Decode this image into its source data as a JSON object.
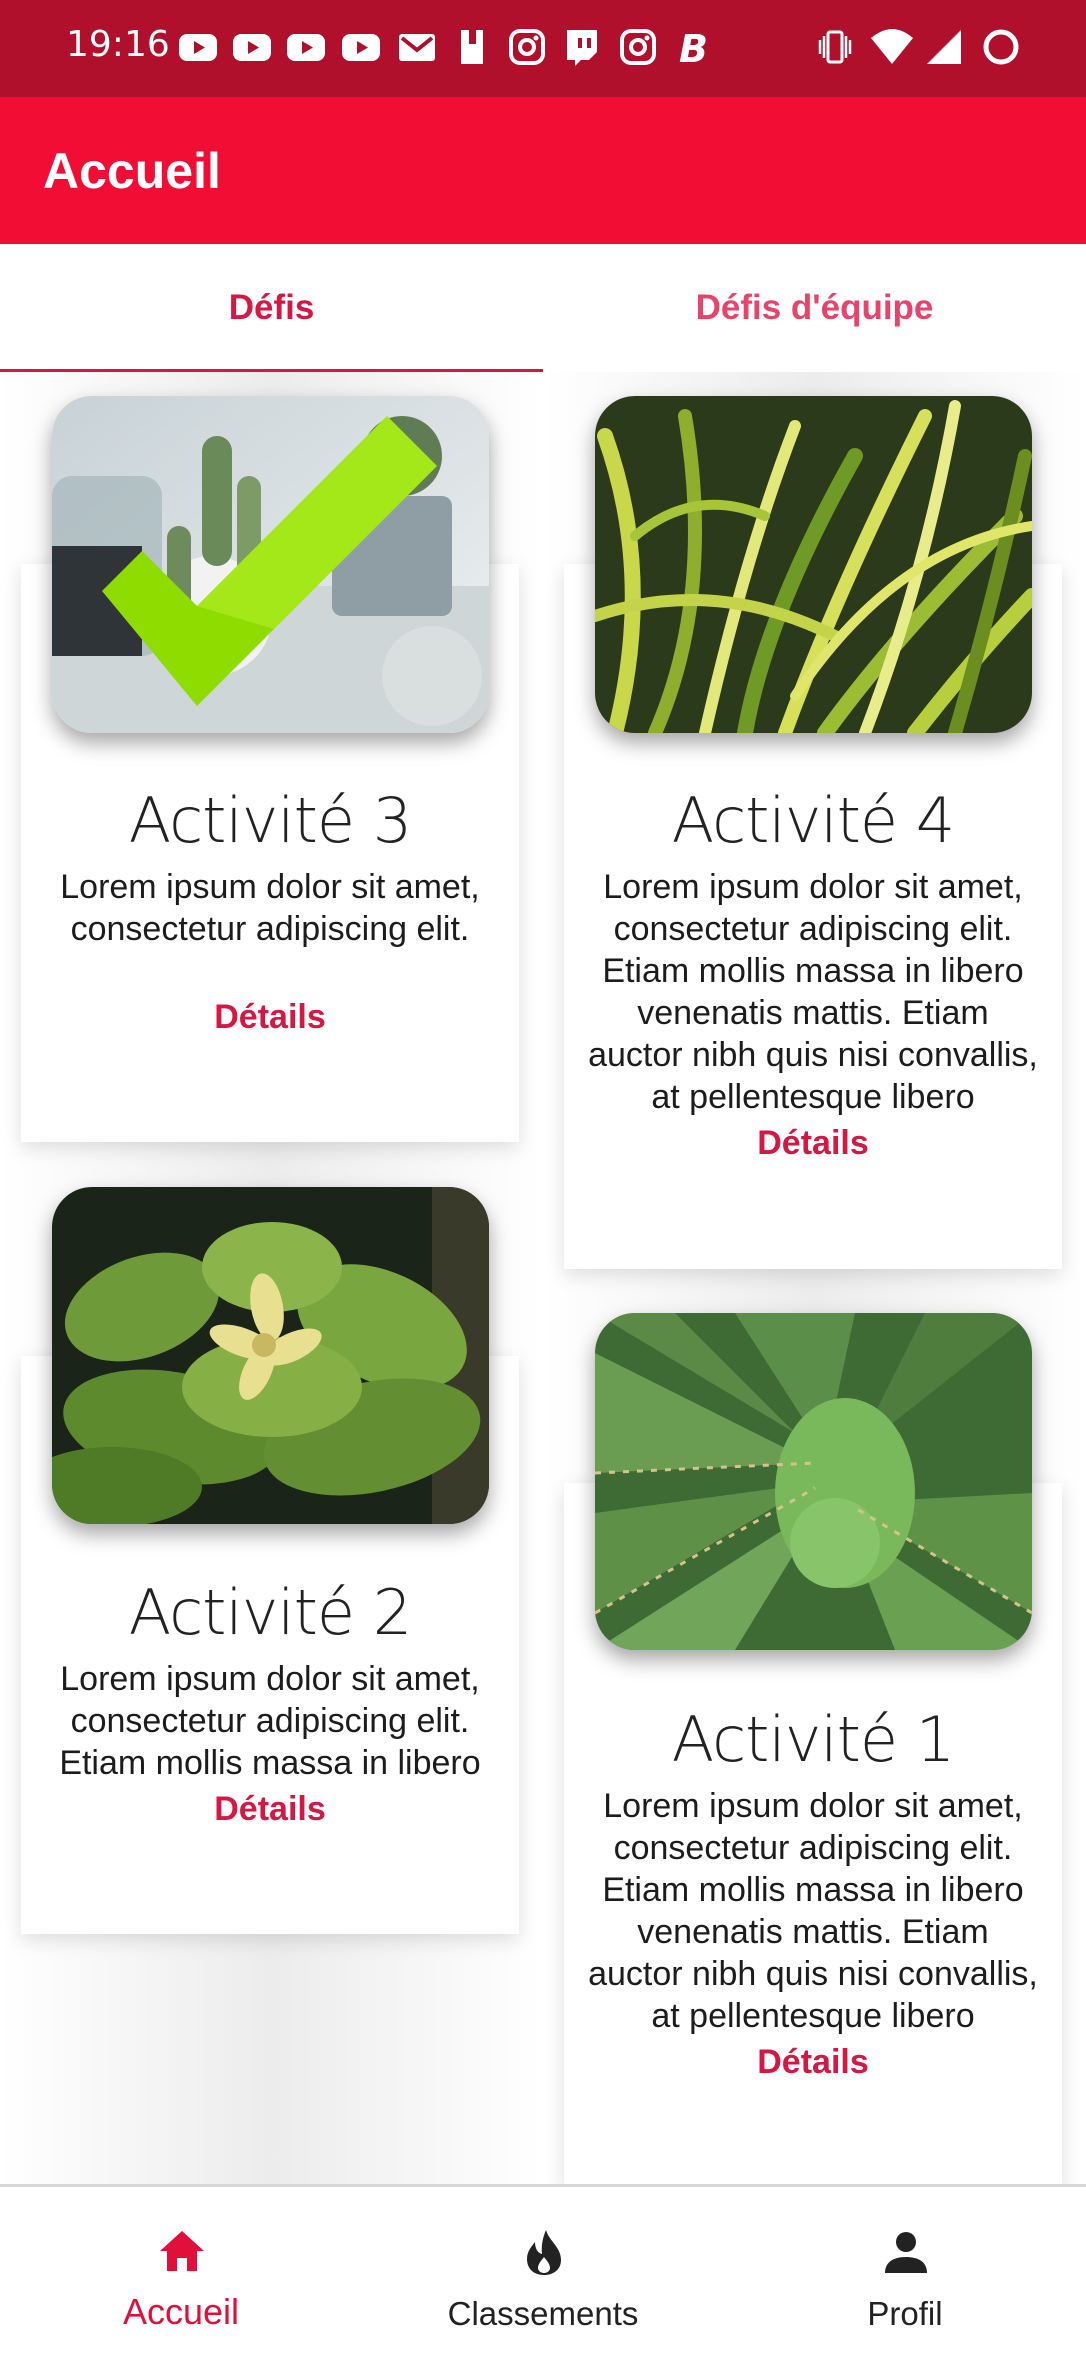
{
  "status_bar": {
    "time": "19:16",
    "left_icons": [
      "youtube-icon",
      "youtube-icon",
      "youtube-icon",
      "youtube-icon",
      "gmail-icon",
      "bookmark-icon",
      "instagram-icon",
      "twitch-icon",
      "instagram-icon",
      "bold-b-icon"
    ],
    "right_icons": [
      "vibrate-icon",
      "wifi-icon",
      "signal-icon",
      "battery-ring-icon"
    ]
  },
  "app_bar": {
    "title": "Accueil"
  },
  "tabs": [
    {
      "label": "Défis",
      "active": true
    },
    {
      "label": "Défis d'équipe",
      "active": false
    }
  ],
  "cards": [
    {
      "title": "Activité 3",
      "description": "Lorem ipsum dolor sit amet, consectetur adipiscing elit.",
      "button": "Détails",
      "image": "cactus-pots-photo",
      "completed": true
    },
    {
      "title": "Activité 4",
      "description": "Lorem ipsum dolor sit amet, consectetur adipiscing elit. Etiam mollis massa in libero venenatis mattis. Etiam auctor nibh quis nisi convallis, at pellentesque libero",
      "button": "Détails",
      "image": "striped-grass-photo",
      "completed": false
    },
    {
      "title": "Activité 2",
      "description": "Lorem ipsum dolor sit amet, consectetur adipiscing elit. Etiam mollis massa in libero venenatis",
      "button": "Détails",
      "image": "leafy-plant-flower-photo",
      "completed": false
    },
    {
      "title": "Activité 1",
      "description": "Lorem ipsum dolor sit amet, consectetur adipiscing elit. Etiam mollis massa in libero venenatis mattis. Etiam auctor nibh quis nisi convallis, at pellentesque libero",
      "button": "Détails",
      "image": "agave-photo",
      "completed": false
    }
  ],
  "bottom_nav": [
    {
      "label": "Accueil",
      "icon": "home-icon",
      "active": true
    },
    {
      "label": "Classements",
      "icon": "flame-icon",
      "active": false
    },
    {
      "label": "Profil",
      "icon": "person-icon",
      "active": false
    }
  ],
  "colors": {
    "status_bar": "#b0102c",
    "app_bar": "#f20d35",
    "accent": "#d41843",
    "check_green": "#8fdc00"
  }
}
